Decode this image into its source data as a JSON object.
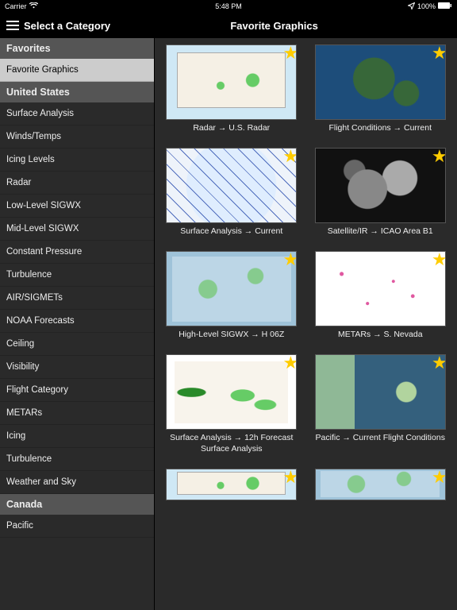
{
  "statusbar": {
    "carrier": "Carrier",
    "wifi": "wifi-icon",
    "time": "5:48 PM",
    "location": "location-icon",
    "battery_pct": "100%"
  },
  "nav": {
    "sidebar_title": "Select a Category",
    "page_title": "Favorite Graphics"
  },
  "sidebar": {
    "sections": [
      {
        "header": "Favorites",
        "items": [
          {
            "label": "Favorite Graphics",
            "selected": true
          }
        ]
      },
      {
        "header": "United States",
        "items": [
          {
            "label": "Surface Analysis"
          },
          {
            "label": "Winds/Temps"
          },
          {
            "label": "Icing Levels"
          },
          {
            "label": "Radar"
          },
          {
            "label": "Low-Level SIGWX"
          },
          {
            "label": "Mid-Level SIGWX"
          },
          {
            "label": "Constant Pressure"
          },
          {
            "label": "Turbulence"
          },
          {
            "label": "AIR/SIGMETs"
          },
          {
            "label": "NOAA Forecasts"
          },
          {
            "label": "Ceiling"
          },
          {
            "label": "Visibility"
          },
          {
            "label": "Flight Category"
          },
          {
            "label": "METARs"
          },
          {
            "label": "Icing"
          },
          {
            "label": "Turbulence"
          },
          {
            "label": "Weather and Sky"
          }
        ]
      },
      {
        "header": "Canada",
        "items": [
          {
            "label": "Pacific"
          }
        ]
      }
    ]
  },
  "graphics": [
    {
      "caption": "Radar → U.S. Radar",
      "thumb": "t-us"
    },
    {
      "caption": "Flight Conditions → Current",
      "thumb": "t-eu"
    },
    {
      "caption": "Surface Analysis → Current",
      "thumb": "t-eu2"
    },
    {
      "caption": "Satellite/IR → ICAO Area B1",
      "thumb": "t-sat"
    },
    {
      "caption": "High-Level SIGWX → H 06Z",
      "thumb": "t-sigwx"
    },
    {
      "caption": "METARs → S. Nevada",
      "thumb": "t-metar"
    },
    {
      "caption": "Surface Analysis → 12h Forecast Surface Analysis",
      "thumb": "t-surf"
    },
    {
      "caption": "Pacific → Current Flight Conditions",
      "thumb": "t-pac"
    },
    {
      "caption": "",
      "thumb": "t-us",
      "partial": true
    },
    {
      "caption": "",
      "thumb": "t-sigwx",
      "partial": true
    }
  ]
}
